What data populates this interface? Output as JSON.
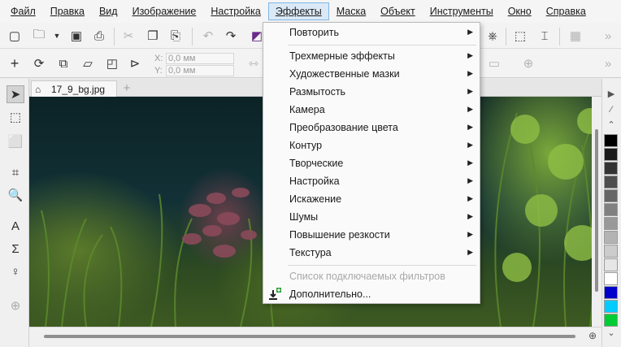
{
  "menubar": {
    "items": [
      {
        "label": "Файл"
      },
      {
        "label": "Правка"
      },
      {
        "label": "Вид"
      },
      {
        "label": "Изображение"
      },
      {
        "label": "Настройка"
      },
      {
        "label": "Эффекты"
      },
      {
        "label": "Маска"
      },
      {
        "label": "Объект"
      },
      {
        "label": "Инструменты"
      },
      {
        "label": "Окно"
      },
      {
        "label": "Справка"
      }
    ],
    "active": "Эффекты"
  },
  "property_bar": {
    "x_label": "X:",
    "x_value": "0,0 мм",
    "y_label": "Y:",
    "y_value": "0,0 мм"
  },
  "document_tab": {
    "filename": "17_9_bg.jpg"
  },
  "effects_menu": {
    "items": [
      {
        "label": "Повторить",
        "submenu": true
      },
      {
        "label": "Трехмерные эффекты",
        "submenu": true
      },
      {
        "label": "Художественные мазки",
        "submenu": true
      },
      {
        "label": "Размытость",
        "submenu": true
      },
      {
        "label": "Камера",
        "submenu": true
      },
      {
        "label": "Преобразование цвета",
        "submenu": true
      },
      {
        "label": "Контур",
        "submenu": true
      },
      {
        "label": "Творческие",
        "submenu": true
      },
      {
        "label": "Настройка",
        "submenu": true
      },
      {
        "label": "Искажение",
        "submenu": true
      },
      {
        "label": "Шумы",
        "submenu": true
      },
      {
        "label": "Повышение резкости",
        "submenu": true
      },
      {
        "label": "Текстура",
        "submenu": true
      },
      {
        "label": "Список подключаемых фильтров",
        "disabled": true
      },
      {
        "label": "Дополнительно..."
      }
    ]
  },
  "palette": {
    "colors": [
      "#000000",
      "#1a1a1a",
      "#333333",
      "#4d4d4d",
      "#666666",
      "#808080",
      "#999999",
      "#b3b3b3",
      "#cccccc",
      "#e6e6e6",
      "#ffffff",
      "#0000cc",
      "#00ccff",
      "#00cc33"
    ]
  }
}
